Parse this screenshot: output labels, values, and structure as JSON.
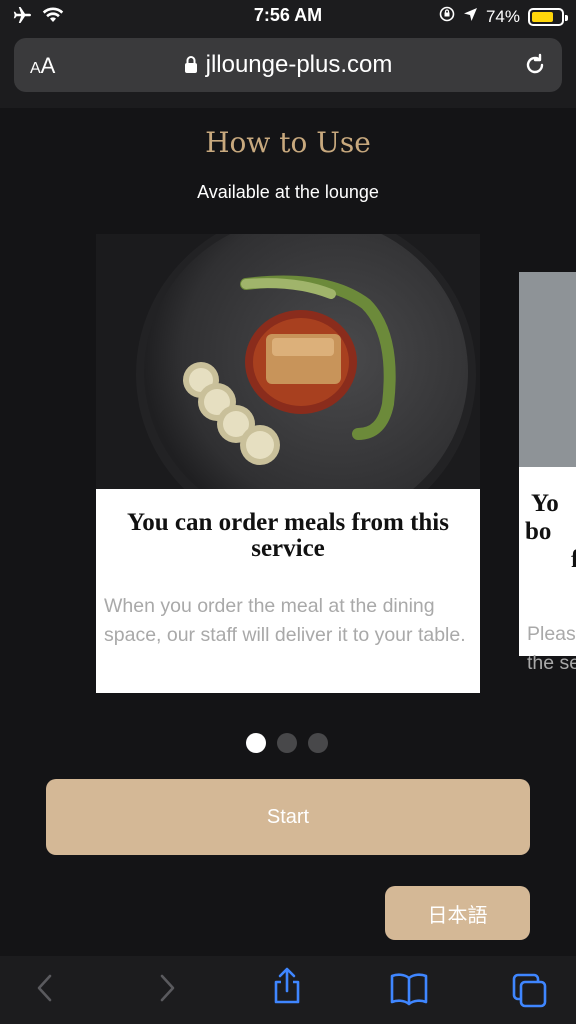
{
  "status_bar": {
    "time": "7:56 AM",
    "battery_text": "74%",
    "battery_level": 0.74,
    "battery_color": "#ffd60a",
    "icons": [
      "airplane-icon",
      "wifi-icon",
      "location-lock-icon",
      "location-arrow-icon",
      "battery-icon"
    ]
  },
  "browser": {
    "text_size_small": "A",
    "text_size_large": "A",
    "domain": "jllounge-plus.com",
    "icons": [
      "lock-icon",
      "reload-icon"
    ]
  },
  "page": {
    "title": "How to Use",
    "subtitle": "Available at the lounge",
    "accent_color": "#c8a97e",
    "button_color": "#d4b896"
  },
  "carousel": {
    "cards": [
      {
        "title": "You can order meals from this service",
        "description": "When you order the meal at the dining space, our staff will deliver it to your table.",
        "image": "plated-dish-photo"
      },
      {
        "title": "Yo\nbo\nf",
        "description": "Pleas\nthe se",
        "image": "partial-photo"
      }
    ],
    "page_count": 3,
    "active_index": 0
  },
  "buttons": {
    "start": "Start",
    "language": "日本語"
  },
  "toolbar": {
    "icons": [
      "back-icon",
      "forward-icon",
      "share-icon",
      "bookmarks-icon",
      "tabs-icon"
    ]
  }
}
